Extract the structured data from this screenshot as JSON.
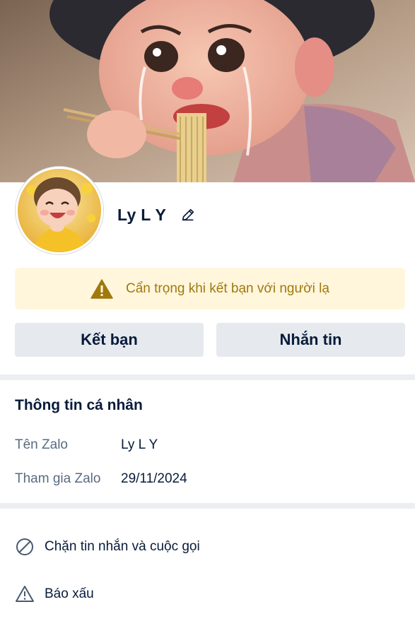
{
  "profile": {
    "display_name": "Ly L Y",
    "cover_image": "crying-cartoon-girl-eating-noodles",
    "avatar_image": "laughing-baby-in-yellow"
  },
  "warning": {
    "text": "Cẩn trọng khi kết bạn với người lạ",
    "icon": "warning-icon",
    "color": "#a0790d",
    "background": "#fff6dc"
  },
  "buttons": {
    "add_friend": "Kết bạn",
    "message": "Nhắn tin"
  },
  "personal_info": {
    "title": "Thông tin cá nhân",
    "rows": [
      {
        "label": "Tên Zalo",
        "value": "Ly L Y"
      },
      {
        "label": "Tham gia Zalo",
        "value": "29/11/2024"
      }
    ]
  },
  "actions": [
    {
      "label": "Chặn tin nhắn và cuộc gọi",
      "icon": "block-icon"
    },
    {
      "label": "Báo xấu",
      "icon": "report-icon"
    }
  ],
  "colors": {
    "text_primary": "#081b3a",
    "text_secondary": "#5a6b80",
    "button_bg": "#e6e9ee",
    "divider": "#eceef2"
  }
}
